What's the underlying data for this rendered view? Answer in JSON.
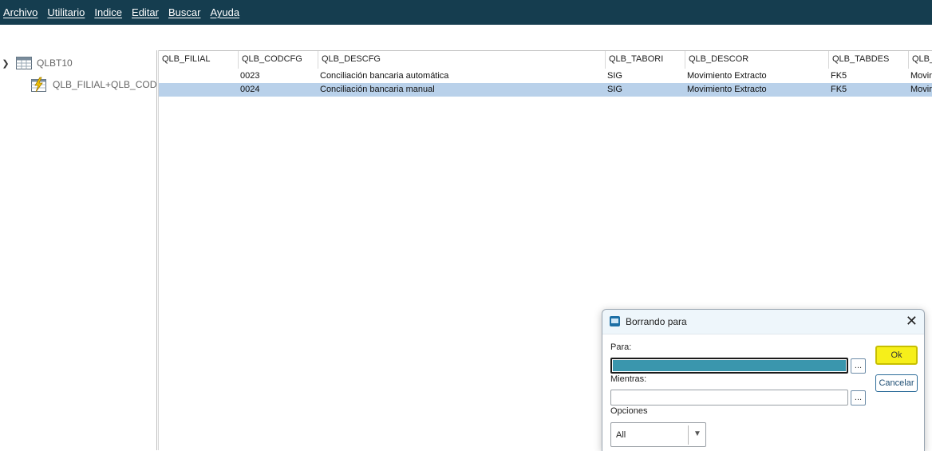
{
  "menu": {
    "items": [
      "Archivo",
      "Utilitario",
      "Indice",
      "Editar",
      "Buscar",
      "Ayuda"
    ]
  },
  "tree": {
    "table_label": "QLBT10",
    "index_label": "QLB_FILIAL+QLB_CODCFG"
  },
  "grid": {
    "columns": [
      "QLB_FILIAL",
      "QLB_CODCFG",
      "QLB_DESCFG",
      "QLB_TABORI",
      "QLB_DESCOR",
      "QLB_TABDES",
      "QLB_"
    ],
    "rows": [
      {
        "filial": "",
        "codcfg": "0023",
        "descfg": "Conciliación bancaria automática",
        "tabori": "SIG",
        "descor": "Movimiento Extracto",
        "tabdes": "FK5",
        "extra": "Movin"
      },
      {
        "filial": "",
        "codcfg": "0024",
        "descfg": "Conciliación bancaria manual",
        "tabori": "SIG",
        "descor": "Movimiento Extracto",
        "tabdes": "FK5",
        "extra": "Movin"
      }
    ],
    "selected_row_color": "#b9d1ea"
  },
  "dialog": {
    "title": "Borrando para",
    "para_label": "Para:",
    "mientras_label": "Mientras:",
    "opciones_label": "Opciones",
    "lookup_label": "...",
    "ok_label": "Ok",
    "cancel_label": "Cancelar",
    "opciones_value": "All"
  },
  "colors": {
    "menubar": "#153d4f",
    "ok_button": "#f6ef1a",
    "focused_field_fill": "#3a96ad"
  }
}
